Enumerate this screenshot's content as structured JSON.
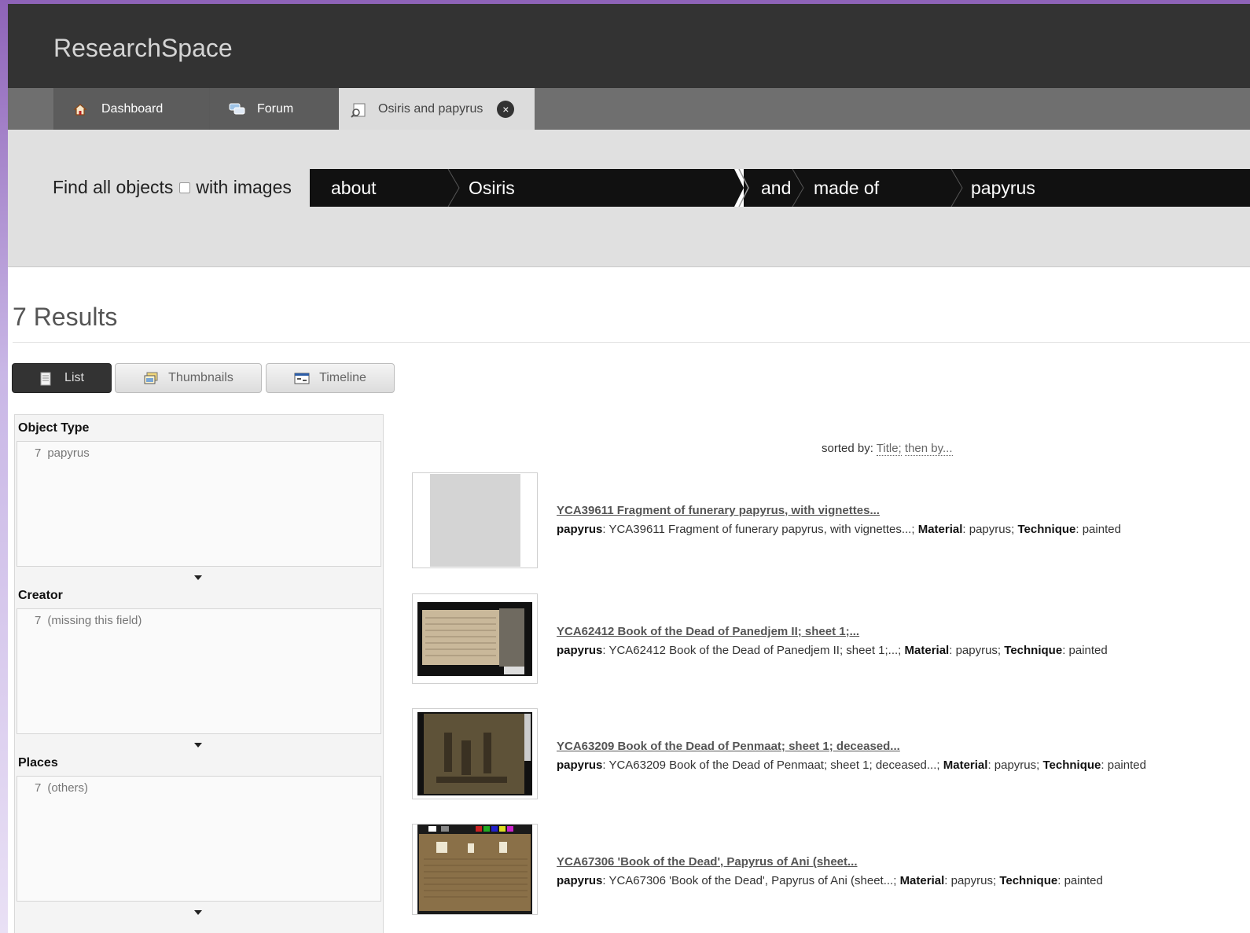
{
  "app": {
    "title": "ResearchSpace"
  },
  "tabs": [
    {
      "label": "Dashboard",
      "icon": "home-icon"
    },
    {
      "label": "Forum",
      "icon": "forum-icon"
    },
    {
      "label": "Osiris and papyrus",
      "icon": "search-doc-icon",
      "close": "×"
    }
  ],
  "query": {
    "find_label": "Find all objects",
    "with_images_label": "with images",
    "segments": [
      "about",
      "Osiris",
      "and",
      "made of",
      "papyrus"
    ]
  },
  "results": {
    "title": "7 Results",
    "views": [
      {
        "label": "List",
        "icon": "list-icon",
        "active": true
      },
      {
        "label": "Thumbnails",
        "icon": "thumbnails-icon",
        "active": false
      },
      {
        "label": "Timeline",
        "icon": "timeline-icon",
        "active": false
      }
    ],
    "sorted_prefix": "sorted by:",
    "sorted_field": "Title;",
    "sorted_then": "then by...",
    "items": [
      {
        "link": "YCA39611 Fragment of funerary papyrus, with vignettes...",
        "type": "papyrus",
        "desc": "YCA39611 Fragment of funerary papyrus, with vignettes...;",
        "material_label": "Material",
        "material": "papyrus;",
        "technique_label": "Technique",
        "technique": "painted"
      },
      {
        "link": "YCA62412 Book of the Dead of Panedjem II; sheet 1;...",
        "type": "papyrus",
        "desc": "YCA62412 Book of the Dead of Panedjem II; sheet 1;...;",
        "material_label": "Material",
        "material": "papyrus;",
        "technique_label": "Technique",
        "technique": "painted"
      },
      {
        "link": "YCA63209 Book of the Dead of Penmaat; sheet 1; deceased...",
        "type": "papyrus",
        "desc": "YCA63209 Book of the Dead of Penmaat; sheet 1; deceased...;",
        "material_label": "Material",
        "material": "papyrus;",
        "technique_label": "Technique",
        "technique": "painted"
      },
      {
        "link": "YCA67306 'Book of the Dead', Papyrus of Ani (sheet...",
        "type": "papyrus",
        "desc": "YCA67306 'Book of the Dead', Papyrus of Ani (sheet...;",
        "material_label": "Material",
        "material": "papyrus;",
        "technique_label": "Technique",
        "technique": "painted"
      }
    ]
  },
  "facets": [
    {
      "title": "Object Type",
      "count": "7",
      "value": "papyrus"
    },
    {
      "title": "Creator",
      "count": "7",
      "value": "(missing this field)"
    },
    {
      "title": "Places",
      "count": "7",
      "value": "(others)"
    }
  ]
}
